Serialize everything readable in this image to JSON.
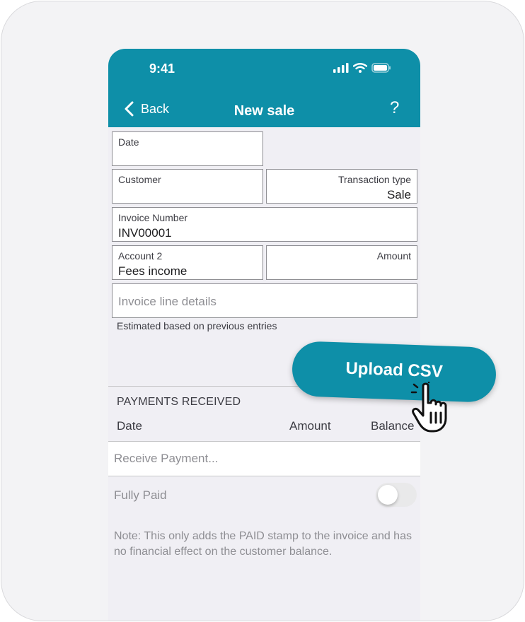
{
  "status_bar": {
    "time": "9:41"
  },
  "header": {
    "back_label": "Back",
    "title": "New sale",
    "help_label": "?"
  },
  "form": {
    "date": {
      "label": "Date",
      "value": ""
    },
    "customer": {
      "label": "Customer",
      "value": ""
    },
    "transaction_type": {
      "label": "Transaction type",
      "value": "Sale"
    },
    "invoice_number": {
      "label": "Invoice Number",
      "value": "INV00001"
    },
    "account": {
      "label": "Account 2",
      "value": "Fees income"
    },
    "amount": {
      "label": "Amount",
      "value": ""
    },
    "line_details": {
      "placeholder": "Invoice line details"
    },
    "hint": "Estimated based on previous entries"
  },
  "payments": {
    "section_title": "PAYMENTS RECEIVED",
    "columns": [
      "Date",
      "Amount",
      "Balance"
    ],
    "receive_label": "Receive Payment...",
    "fully_paid_label": "Fully Paid",
    "fully_paid_on": false,
    "note": "Note: This only adds the PAID stamp to the invoice and has no financial effect on the customer balance."
  },
  "overlay": {
    "upload_label": "Upload CSV"
  },
  "colors": {
    "accent": "#0e8fa8",
    "background": "#f0eff4"
  }
}
